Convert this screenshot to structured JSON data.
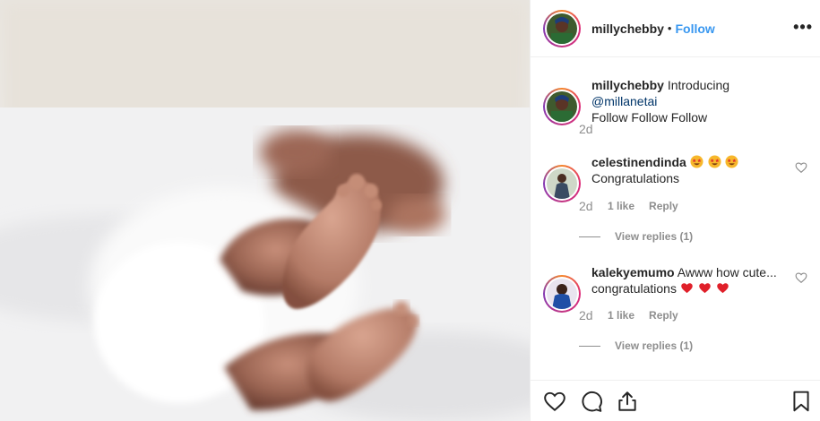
{
  "post": {
    "author": "millychebby",
    "separator": "•",
    "follow_label": "Follow",
    "more_label": "•••"
  },
  "caption": {
    "username": "millychebby",
    "text": "Introducing ",
    "mention": "@millanetai",
    "line2": "Follow Follow Follow",
    "time": "2d"
  },
  "comments": [
    {
      "username": "celestinendinda",
      "emojis": [
        "star-struck-emoji",
        "star-struck-emoji",
        "star-struck-emoji"
      ],
      "text": "Congratulations",
      "time": "2d",
      "likes": "1 like",
      "reply_label": "Reply",
      "view_replies": "View replies (1)"
    },
    {
      "username": "kalekyemumo",
      "text": "Awww how cute...",
      "line2": "congratulations",
      "emojis": [
        "red-heart-emoji",
        "red-heart-emoji",
        "red-heart-emoji"
      ],
      "time": "2d",
      "likes": "1 like",
      "reply_label": "Reply",
      "view_replies": "View replies (1)"
    }
  ],
  "icons": {
    "like": "heart-icon",
    "comment": "comment-icon",
    "share": "share-icon",
    "save": "bookmark-icon"
  },
  "colors": {
    "follow": "#3897f0",
    "mention": "#003569",
    "muted": "#8e8e8e",
    "heart": "#ed1c24"
  }
}
